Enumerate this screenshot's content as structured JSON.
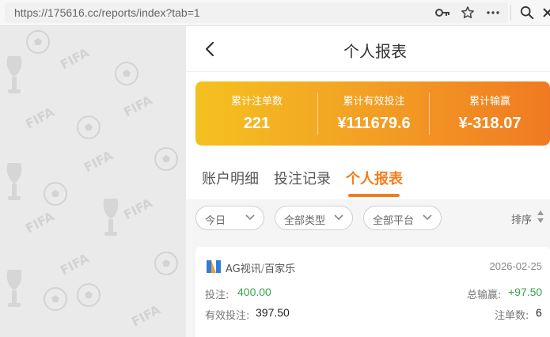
{
  "browser": {
    "url": "https://175616.cc/reports/index?tab=1",
    "icons": [
      "key-icon",
      "star-icon",
      "more-icon",
      "search-icon"
    ]
  },
  "header": {
    "title": "个人报表",
    "back_icon": "chevron-left-icon"
  },
  "summary": {
    "colors": {
      "start": "#f4c11f",
      "end": "#f07a22"
    },
    "stats": [
      {
        "label": "累计注单数",
        "value": "221"
      },
      {
        "label": "累计有效投注",
        "value": "¥111679.6"
      },
      {
        "label": "累计输赢",
        "value": "¥-318.07"
      }
    ]
  },
  "tabs": [
    {
      "label": "账户明细",
      "active": false
    },
    {
      "label": "投注记录",
      "active": false
    },
    {
      "label": "个人报表",
      "active": true
    }
  ],
  "accent_color": "#f27d1e",
  "filters": [
    {
      "label": "今日"
    },
    {
      "label": "全部类型"
    },
    {
      "label": "全部平台"
    }
  ],
  "sort": {
    "label": "排序"
  },
  "records": [
    {
      "platform": "AG视讯",
      "separator": "/",
      "game": "百家乐",
      "date": "2026-02-25",
      "bet_label": "投注:",
      "bet_value": "400.00",
      "win_label": "总输赢:",
      "win_value": "+97.50",
      "valid_label": "有效投注:",
      "valid_value": "397.50",
      "count_label": "注单数:",
      "count_value": "6"
    }
  ]
}
